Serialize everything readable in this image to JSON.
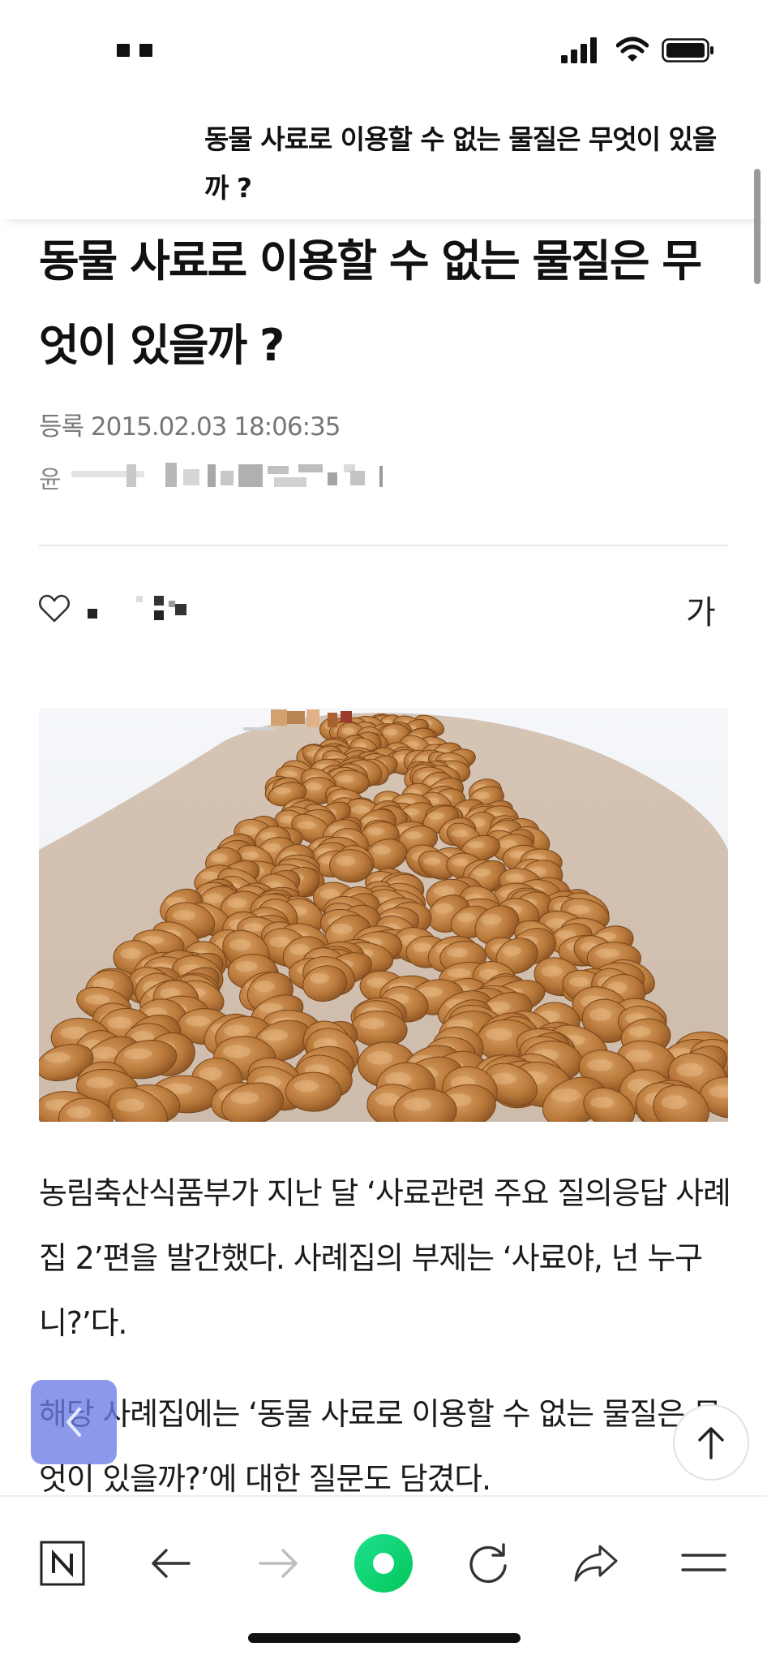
{
  "status_bar": {
    "icons": [
      "signal-icon",
      "wifi-icon",
      "battery-icon"
    ]
  },
  "header": {
    "sticky_title": "동물 사료로 이용할 수 없는 물질은 무엇이 있을까 ?"
  },
  "article": {
    "title": "동물 사료로 이용할 수 없는 물질은 무엇이 있을까 ?",
    "date": "등록 2015.02.03 18:06:35",
    "author_initial": "윤"
  },
  "actions": {
    "font_size_label": "가"
  },
  "image": {
    "subject": "dry pet food kibble pile"
  },
  "body": {
    "paragraph_1": "농림축산식품부가 지난 달 ‘사료관련 주요 질의응답 사례집 2’편을 발간했다. 사례집의 부제는 ‘사료야, 넌 누구니?’다.",
    "paragraph_2": "해당 사례집에는 ‘동물 사료로 이용할 수 없는 물질은 무엇이 있을까?’에 대한 질문도 담겼다."
  },
  "toolbar": {
    "icons": [
      "naver-home-icon",
      "back-arrow-icon",
      "forward-arrow-icon",
      "green-dot-icon",
      "refresh-icon",
      "share-icon",
      "menu-icon"
    ]
  },
  "colors": {
    "accent_green": "#03C75A",
    "floating_back": "#6C7CE6",
    "meta_gray": "#777777"
  }
}
